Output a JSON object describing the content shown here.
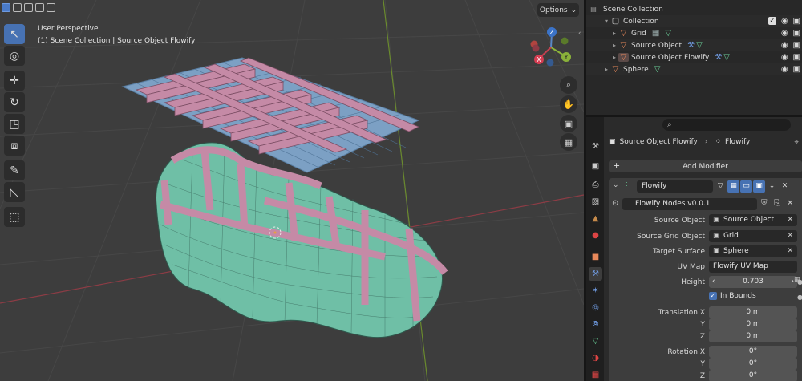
{
  "viewport": {
    "line1": "User Perspective",
    "line2": "(1) Scene Collection | Source Object Flowify",
    "options_label": "Options",
    "gizmo": {
      "x": "X",
      "y": "Y",
      "z": "Z"
    }
  },
  "toolbar": {
    "tools": [
      "select-box",
      "cursor",
      "move",
      "rotate",
      "scale",
      "transform",
      "annotate",
      "measure",
      "add-cube"
    ]
  },
  "outliner": {
    "scene_collection": "Scene Collection",
    "rows": [
      {
        "label": "Collection"
      },
      {
        "label": "Grid"
      },
      {
        "label": "Source Object"
      },
      {
        "label": "Source Object Flowify"
      },
      {
        "label": "Sphere"
      }
    ]
  },
  "properties": {
    "breadcrumb_object": "Source Object Flowify",
    "breadcrumb_modifier": "Flowify",
    "add_modifier": "Add Modifier",
    "modifier_name": "Flowify",
    "node_group": "Flowify Nodes v0.0.1",
    "fields": {
      "source_object": {
        "label": "Source Object",
        "value": "Source Object"
      },
      "source_grid": {
        "label": "Source Grid Object",
        "value": "Grid"
      },
      "target_surface": {
        "label": "Target Surface",
        "value": "Sphere"
      },
      "uv_map": {
        "label": "UV Map",
        "value": "Flowify UV Map"
      },
      "height": {
        "label": "Height",
        "value": "0.703"
      },
      "in_bounds": {
        "label": "In Bounds"
      },
      "translation": {
        "label_x": "Translation X",
        "label_y": "Y",
        "label_z": "Z",
        "x": "0 m",
        "y": "0 m",
        "z": "0 m"
      },
      "rotation": {
        "label_x": "Rotation X",
        "label_y": "Y",
        "label_z": "Z",
        "x": "0°",
        "y": "0°",
        "z": "0°"
      }
    }
  },
  "colors": {
    "accent": "#4772b3",
    "pink_mesh": "#c58aa6",
    "teal_mesh": "#6fbfa6",
    "blue_grid": "#7ca0c4"
  }
}
